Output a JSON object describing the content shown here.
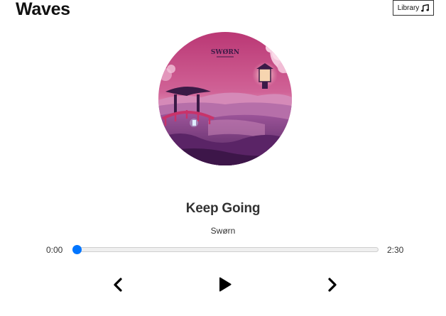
{
  "header": {
    "title": "Waves",
    "library_label": "Library",
    "library_icon": "music-note-icon"
  },
  "now_playing": {
    "cover_art_text": "SWØRN",
    "title": "Keep Going",
    "artist": "Swørn",
    "current_time": "0:00",
    "total_time": "2:30",
    "progress": 0.0
  },
  "controls": {
    "prev_icon": "chevron-left-icon",
    "play_icon": "play-icon",
    "next_icon": "chevron-right-icon"
  },
  "colors": {
    "accent": "#0075ff",
    "cover_sky": "#c2457f",
    "cover_water": "#7b2e6a"
  }
}
